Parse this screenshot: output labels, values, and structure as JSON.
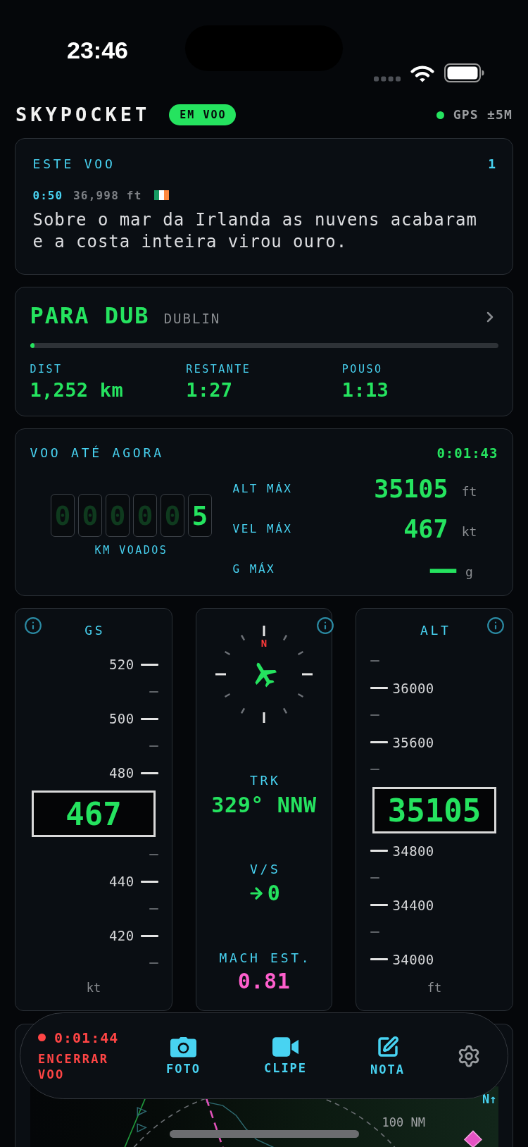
{
  "status_bar": {
    "time": "23:46"
  },
  "header": {
    "app_name": "SKYPOCKET",
    "badge": "EM VOO",
    "gps": {
      "label": "GPS ±5M",
      "locked": true
    }
  },
  "flight_note": {
    "title": "ESTE VOO",
    "count": "1",
    "time": "0:50",
    "altitude": "36,998 ft",
    "text": "Sobre o mar da Irlanda as nuvens acabaram e a costa inteira virou ouro."
  },
  "destination": {
    "title": "PARA DUB",
    "city": "DUBLIN",
    "progress": {
      "level": 0.01
    },
    "stats": [
      {
        "label": "DIST",
        "value": "1,252 km"
      },
      {
        "label": "RESTANTE",
        "value": "1:27"
      },
      {
        "label": "POUSO",
        "value": "1:13"
      }
    ]
  },
  "flight_summary": {
    "title": "VOO ATÉ AGORA",
    "elapsed": "0:01:43",
    "odometer": {
      "digits": [
        {
          "value": "0",
          "lit": false
        },
        {
          "value": "0",
          "lit": false
        },
        {
          "value": "0",
          "lit": false
        },
        {
          "value": "0",
          "lit": false
        },
        {
          "value": "0",
          "lit": false
        },
        {
          "value": "5",
          "lit": true
        }
      ],
      "label": "KM VOADOS"
    },
    "stats": [
      {
        "label": "ALT MÁX",
        "value": "35105",
        "unit": "ft",
        "available": true
      },
      {
        "label": "VEL MÁX",
        "value": "467",
        "unit": "kt",
        "available": true
      },
      {
        "label": "G MÁX",
        "value": "—",
        "unit": "g",
        "available": false
      }
    ]
  },
  "instruments": {
    "speed_tape": {
      "label": "GS",
      "ticks_above": [
        {
          "kind": "major",
          "label": "520"
        },
        {
          "kind": "minor"
        },
        {
          "kind": "major",
          "label": "500"
        },
        {
          "kind": "minor"
        },
        {
          "kind": "major",
          "label": "480"
        }
      ],
      "readout": "467",
      "ticks_below": [
        {
          "kind": "minor"
        },
        {
          "kind": "major",
          "label": "440"
        },
        {
          "kind": "minor"
        },
        {
          "kind": "major",
          "label": "420"
        },
        {
          "kind": "minor"
        }
      ],
      "unit": "kt"
    },
    "center": {
      "compass": {
        "north_label": "N"
      },
      "track": {
        "label": "TRK",
        "value": "329° NNW"
      },
      "vertical_speed": {
        "label": "V/S",
        "value": "0"
      },
      "mach": {
        "label": "MACH EST.",
        "value": "0.81"
      }
    },
    "altitude_tape": {
      "label": "ALT",
      "ticks_above": [
        {
          "kind": "minor"
        },
        {
          "kind": "major",
          "label": "36000"
        },
        {
          "kind": "minor"
        },
        {
          "kind": "major",
          "label": "35600"
        },
        {
          "kind": "minor"
        }
      ],
      "readout": "35105",
      "ticks_below": [
        {
          "kind": "major",
          "label": "34800"
        },
        {
          "kind": "minor"
        },
        {
          "kind": "major",
          "label": "34400"
        },
        {
          "kind": "minor"
        },
        {
          "kind": "major",
          "label": "34000"
        }
      ],
      "unit": "ft"
    }
  },
  "map": {
    "north_label": "N↑",
    "range_label": "100 NM"
  },
  "action_bar": {
    "timer": "0:01:44",
    "recording": true,
    "end_button": "ENCERRAR VOO",
    "actions": [
      {
        "kind": "photo",
        "label": "FOTO"
      },
      {
        "kind": "clip",
        "label": "CLIPE"
      },
      {
        "kind": "note",
        "label": "NOTA"
      }
    ]
  }
}
